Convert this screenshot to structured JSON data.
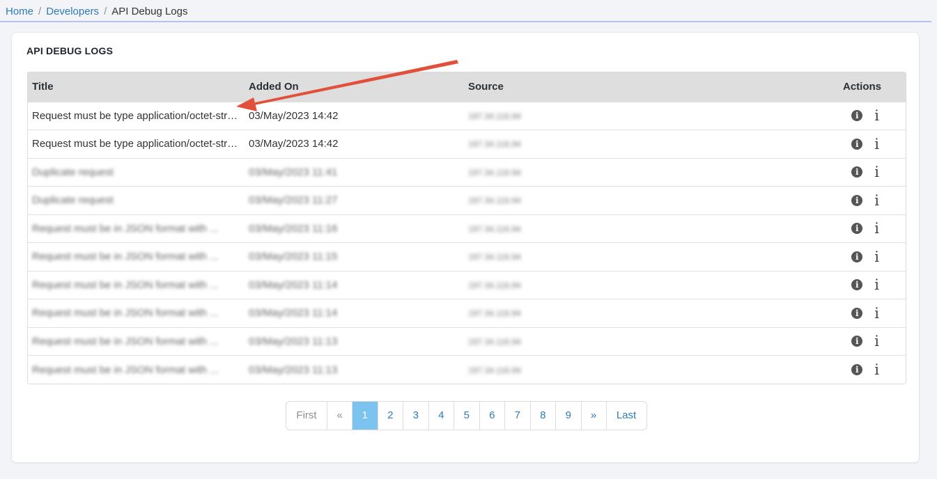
{
  "breadcrumb": {
    "items": [
      "Home",
      "Developers"
    ],
    "current": "API Debug Logs"
  },
  "card": {
    "title": "API DEBUG LOGS"
  },
  "table": {
    "columns": [
      "Title",
      "Added On",
      "Source",
      "Actions"
    ],
    "rows": [
      {
        "title": "Request must be type application/octet-stream",
        "added_on": "03/May/2023 14:42",
        "source": "197.34.116.94",
        "blurred": false
      },
      {
        "title": "Request must be type application/octet-stream",
        "added_on": "03/May/2023 14:42",
        "source": "197.34.116.94",
        "blurred": false
      },
      {
        "title": "Duplicate request",
        "added_on": "03/May/2023 11:41",
        "source": "197.34.116.94",
        "blurred": true
      },
      {
        "title": "Duplicate request",
        "added_on": "03/May/2023 11:27",
        "source": "197.34.116.94",
        "blurred": true
      },
      {
        "title": "Request must be in JSON format with ...",
        "added_on": "03/May/2023 11:16",
        "source": "197.34.116.94",
        "blurred": true
      },
      {
        "title": "Request must be in JSON format with ...",
        "added_on": "03/May/2023 11:15",
        "source": "197.34.116.94",
        "blurred": true
      },
      {
        "title": "Request must be in JSON format with ...",
        "added_on": "03/May/2023 11:14",
        "source": "197.34.116.94",
        "blurred": true
      },
      {
        "title": "Request must be in JSON format with ...",
        "added_on": "03/May/2023 11:14",
        "source": "197.34.116.94",
        "blurred": true
      },
      {
        "title": "Request must be in JSON format with ...",
        "added_on": "03/May/2023 11:13",
        "source": "197.34.116.94",
        "blurred": true
      },
      {
        "title": "Request must be in JSON format with ...",
        "added_on": "03/May/2023 11:13",
        "source": "197.34.116.94",
        "blurred": true
      }
    ],
    "row_actions": [
      {
        "icon": "info-circle-icon",
        "glyph": "i"
      },
      {
        "icon": "info-icon",
        "glyph": "i"
      }
    ]
  },
  "pagination": {
    "items": [
      {
        "label": "First",
        "type": "first"
      },
      {
        "label": "«",
        "type": "prev"
      },
      {
        "label": "1",
        "type": "page",
        "active": true
      },
      {
        "label": "2",
        "type": "page"
      },
      {
        "label": "3",
        "type": "page"
      },
      {
        "label": "4",
        "type": "page"
      },
      {
        "label": "5",
        "type": "page"
      },
      {
        "label": "6",
        "type": "page"
      },
      {
        "label": "7",
        "type": "page"
      },
      {
        "label": "8",
        "type": "page"
      },
      {
        "label": "9",
        "type": "page"
      },
      {
        "label": "»",
        "type": "next"
      },
      {
        "label": "Last",
        "type": "last"
      }
    ]
  },
  "colors": {
    "link": "#2e7ab8",
    "active_page": "#7cc4ef",
    "header_bg": "#dedede",
    "annotation_arrow": "#e0503a"
  }
}
